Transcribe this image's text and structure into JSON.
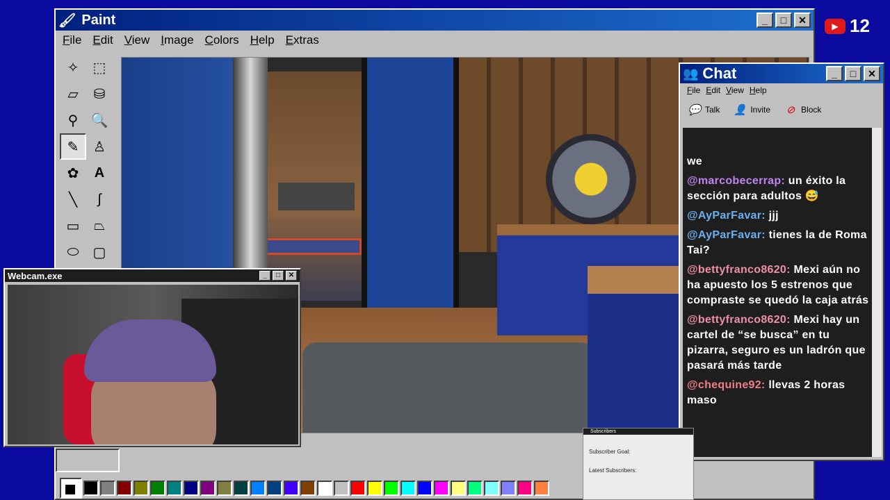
{
  "paint": {
    "title": "Paint",
    "menu": [
      "File",
      "Edit",
      "View",
      "Image",
      "Colors",
      "Help",
      "Extras"
    ],
    "palette": [
      "#000000",
      "#808080",
      "#800000",
      "#808000",
      "#008000",
      "#008080",
      "#000080",
      "#800080",
      "#808040",
      "#004040",
      "#0080ff",
      "#004080",
      "#4000ff",
      "#804000",
      "#ffffff",
      "#c0c0c0",
      "#ff0000",
      "#ffff00",
      "#00ff00",
      "#00ffff",
      "#0000ff",
      "#ff00ff",
      "#ffff80",
      "#00ff80",
      "#80ffff",
      "#8080ff",
      "#ff0080",
      "#ff8040"
    ]
  },
  "chat": {
    "title": "Chat",
    "menu": [
      "File",
      "Edit",
      "View",
      "Help"
    ],
    "tools": {
      "talk": "Talk",
      "invite": "Invite",
      "block": "Block"
    },
    "messages": [
      {
        "user": "",
        "text": "we",
        "color": "#ffffff"
      },
      {
        "user": "@marcobecerrap:",
        "text": "un éxito la sección para adultos 😅",
        "color": "#c084f0"
      },
      {
        "user": "@AyParFavar:",
        "text": "jjj",
        "color": "#6ab0f0"
      },
      {
        "user": "@AyParFavar:",
        "text": "tienes la de Roma Tai?",
        "color": "#6ab0f0"
      },
      {
        "user": "@bettyfranco8620:",
        "text": "Mexi aún no ha apuesto los 5 estrenos que compraste se quedó la caja atrás",
        "color": "#ef8fa8"
      },
      {
        "user": "@bettyfranco8620:",
        "text": "Mexi hay un cartel de “se busca” en tu pizarra, seguro es un ladrón que pasará más tarde",
        "color": "#ef8fa8"
      },
      {
        "user": "@chequine92:",
        "text": "llevas 2 horas maso",
        "color": "#ef7f88"
      }
    ]
  },
  "webcam": {
    "title": "Webcam.exe"
  },
  "subscribers": {
    "title": "Subscribers",
    "goal_label": "Subscriber Goal:",
    "latest_label": "Latest Subscribers:"
  },
  "youtube": {
    "count": "12"
  }
}
